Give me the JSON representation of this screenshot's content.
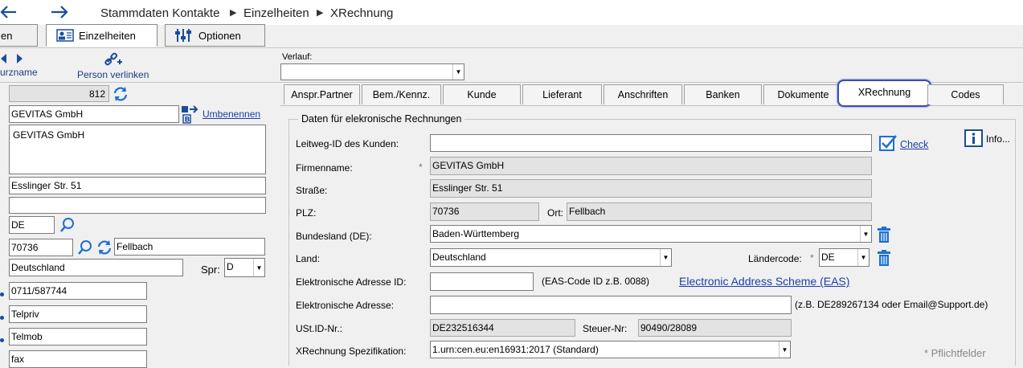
{
  "breadcrumb": {
    "part1": "Stammdaten Kontakte",
    "part2": "Einzelheiten",
    "part3": "XRechnung"
  },
  "toolbar": {
    "tab_partial": "en",
    "tab_einzelheiten": "Einzelheiten",
    "tab_optionen": "Optionen"
  },
  "nav": {
    "kurzname_label": "urzname",
    "person_verlinken_label": "Person verlinken",
    "verlauf_label": "Verlauf:",
    "verlauf_value": ""
  },
  "left": {
    "id_value": "812",
    "company_value": "GEVITAS GmbH",
    "umbenennen_label": "Umbenennen",
    "name_block": "GEVITAS GmbH",
    "street": "Esslinger Str. 51",
    "street2": "",
    "country_code": "DE",
    "plz": "70736",
    "city": "Fellbach",
    "country": "Deutschland",
    "spr_label": "Spr:",
    "spr_value": "D",
    "phone": "0711/587744",
    "telpriv": "Telpriv",
    "telmob": "Telmob",
    "fax": "fax"
  },
  "tabs": [
    "Anspr.Partner",
    "Bem./Kennz.",
    "Kunde",
    "Lieferant",
    "Anschriften",
    "Banken",
    "Dokumente",
    "XRechnung",
    "Codes"
  ],
  "xrechnung": {
    "legend": "Daten für elekronische Rechnungen",
    "info_label": "Info...",
    "leitweg_label": "Leitweg-ID des Kunden:",
    "leitweg_value": "",
    "check_label": "Check",
    "firmenname_label": "Firmenname:",
    "required_star": "*",
    "firmenname_value": "GEVITAS GmbH",
    "strasse_label": "Straße:",
    "strasse_value": "Esslinger Str. 51",
    "plz_label": "PLZ:",
    "plz_value": "70736",
    "ort_label": "Ort:",
    "ort_value": "Fellbach",
    "bundesland_label": "Bundesland (DE):",
    "bundesland_value": "Baden-Württemberg",
    "land_label": "Land:",
    "land_value": "Deutschland",
    "laendercode_label": "Ländercode:",
    "laendercode_value": "DE",
    "el_adresse_id_label": "Elektronische Adresse ID:",
    "el_adresse_id_value": "",
    "eas_hint": "(EAS-Code ID z.B. 0088)",
    "eas_link": "Electronic Address Scheme (EAS)",
    "el_adresse_label": "Elektronische Adresse:",
    "el_adresse_value": "",
    "el_adresse_hint": "(z.B. DE289267134 oder Email@Support.de)",
    "ustid_label": "USt.ID-Nr.:",
    "ustid_value": "DE232516344",
    "steuer_label": "Steuer-Nr:",
    "steuer_value": "90490/28089",
    "spez_label": "XRechnung Spezifikation:",
    "spez_value": "1.urn:cen.eu:en16931:2017 (Standard)",
    "pflicht_note": "* Pflichtfelder"
  },
  "colors": {
    "accent": "#1c6fd4",
    "link": "#1a3fa8",
    "active_tab_border": "#3a4fb0"
  }
}
